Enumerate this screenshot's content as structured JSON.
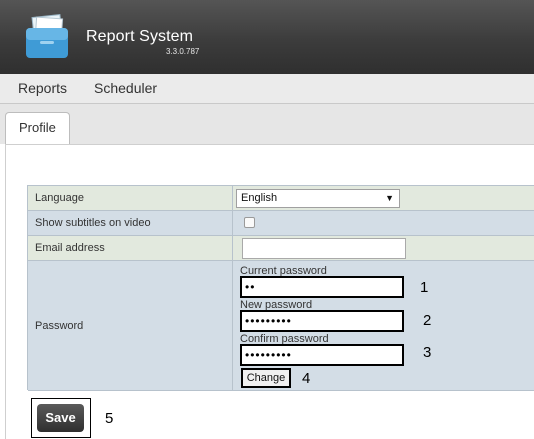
{
  "header": {
    "title": "Report System",
    "version": "3.3.0.787"
  },
  "menu": {
    "items": [
      {
        "label": "Reports"
      },
      {
        "label": "Scheduler"
      }
    ]
  },
  "tabs": [
    {
      "label": "Profile"
    }
  ],
  "form": {
    "language": {
      "label": "Language",
      "selected": "English"
    },
    "subtitles": {
      "label": "Show subtitles on video",
      "checked": false
    },
    "email": {
      "label": "Email address",
      "value": ""
    },
    "password": {
      "label": "Password",
      "current_label": "Current password",
      "current_value": "••",
      "new_label": "New password",
      "new_value": "•••••••••",
      "confirm_label": "Confirm password",
      "confirm_value": "•••••••••",
      "change_label": "Change"
    }
  },
  "annotations": {
    "a1": "1",
    "a2": "2",
    "a3": "3",
    "a4": "4",
    "a5": "5"
  },
  "save_label": "Save",
  "colors": {
    "header_dark": "#3c3c3c",
    "row_green": "#e2e9de",
    "row_blue": "#d3dde6"
  }
}
